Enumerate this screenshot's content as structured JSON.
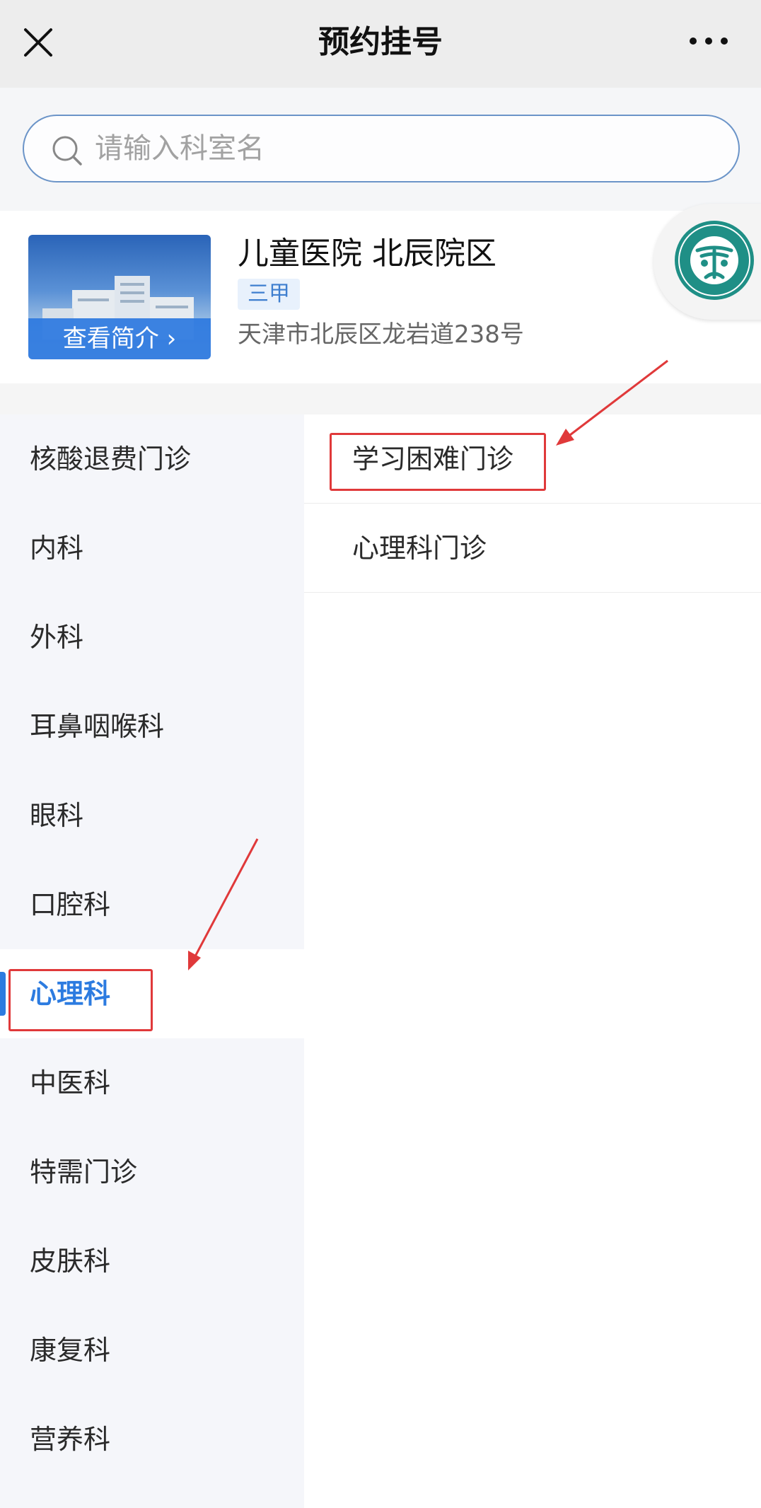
{
  "nav": {
    "title": "预约挂号"
  },
  "search": {
    "placeholder": "请输入科室名"
  },
  "hospital": {
    "name": "儿童医院 北辰院区",
    "level": "三甲",
    "address": "天津市北辰区龙岩道238号",
    "intro_label": "查看简介 ›"
  },
  "left_departments": [
    {
      "label": "核酸退费门诊"
    },
    {
      "label": "内科"
    },
    {
      "label": "外科"
    },
    {
      "label": "耳鼻咽喉科"
    },
    {
      "label": "眼科"
    },
    {
      "label": "口腔科"
    },
    {
      "label": "心理科",
      "selected": true
    },
    {
      "label": "中医科"
    },
    {
      "label": "特需门诊"
    },
    {
      "label": "皮肤科"
    },
    {
      "label": "康复科"
    },
    {
      "label": "营养科"
    }
  ],
  "right_clinics": [
    {
      "label": "学习困难门诊"
    },
    {
      "label": "心理科门诊"
    }
  ],
  "colors": {
    "accent": "#2c7be0",
    "annotation": "#e0393a",
    "logo": "#1f8f86"
  }
}
